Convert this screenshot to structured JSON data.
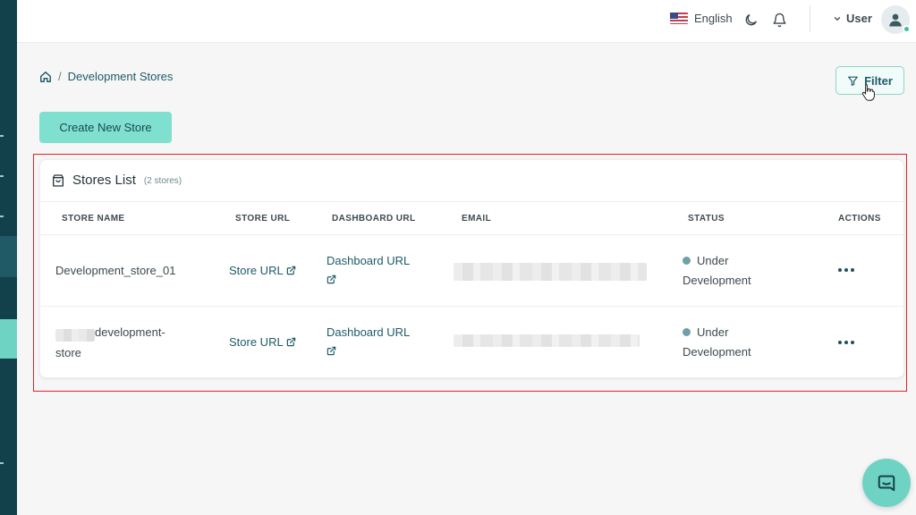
{
  "topbar": {
    "language": "English",
    "user_label": "User"
  },
  "breadcrumb": {
    "current": "Development Stores"
  },
  "toolbar": {
    "filter_label": "Filter",
    "create_label": "Create New Store"
  },
  "stores_list": {
    "title": "Stores List",
    "count": "(2 stores)",
    "columns": [
      "STORE NAME",
      "STORE URL",
      "DASHBOARD URL",
      "EMAIL",
      "STATUS",
      "ACTIONS"
    ],
    "rows": [
      {
        "store_name": "Development_store_01",
        "store_url": "Store URL",
        "dashboard_url": "Dashboard URL",
        "status_line1": "Under",
        "status_line2": "Development"
      },
      {
        "store_name_line1": "development-",
        "store_name_line2": "store",
        "store_url": "Store URL",
        "dashboard_url": "Dashboard URL",
        "status_line1": "Under",
        "status_line2": "Development"
      }
    ]
  },
  "colors": {
    "sidebar": "#12414b",
    "accent": "#7fe0cf",
    "link": "#1e5b66",
    "highlight_frame": "#e2222a",
    "status_dot": "#6f9fa7"
  },
  "icons": {
    "home": "home-icon",
    "filter": "funnel-icon",
    "moon": "moon-icon",
    "bell": "bell-icon",
    "bag": "shopping-bag-icon",
    "external": "external-link-icon",
    "chat": "chat-icon"
  }
}
